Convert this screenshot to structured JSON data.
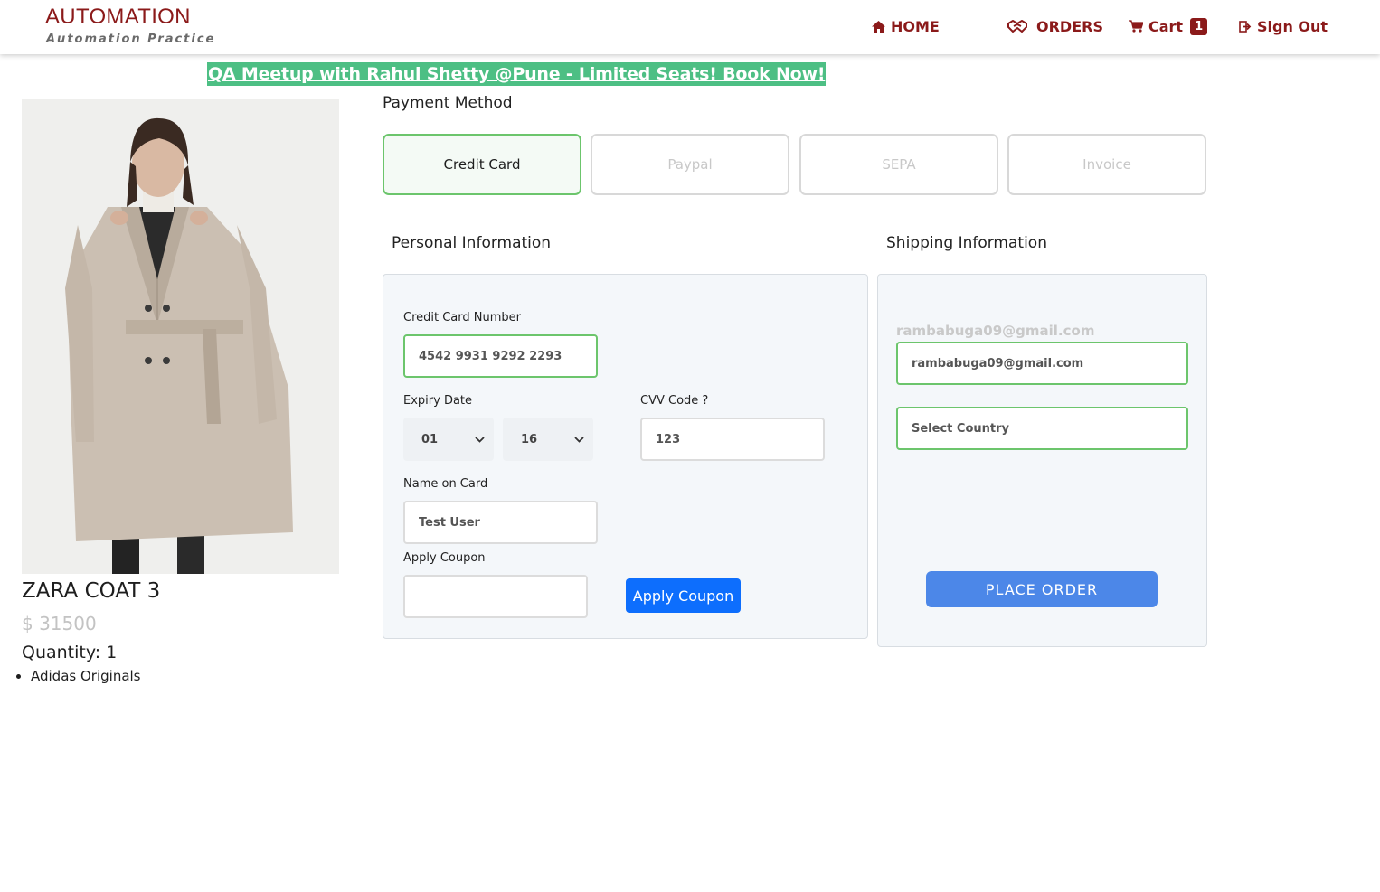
{
  "header": {
    "brand_title": "AUTOMATION",
    "brand_subtitle": "Automation Practice",
    "nav": {
      "home": "HOME",
      "orders": "ORDERS",
      "cart": "Cart",
      "cart_count": "1",
      "sign_out": "Sign Out"
    },
    "accent_color": "#8b1a1a"
  },
  "banner": {
    "text": "QA Meetup with Rahul Shetty @Pune - Limited Seats! Book Now!",
    "color": "#4dbf84"
  },
  "product": {
    "name": "ZARA COAT 3",
    "price": "$ 31500",
    "quantity": "Quantity: 1",
    "tags": [
      "Adidas Originals"
    ]
  },
  "payment": {
    "title": "Payment Method",
    "tabs": [
      {
        "label": "Credit Card",
        "active": true
      },
      {
        "label": "Paypal",
        "active": false
      },
      {
        "label": "SEPA",
        "active": false
      },
      {
        "label": "Invoice",
        "active": false
      }
    ]
  },
  "personal": {
    "title": "Personal Information",
    "card_number_label": "Credit Card Number",
    "card_number_value": "4542 9931 9292 2293",
    "expiry_label": "Expiry Date",
    "expiry_month": "01",
    "expiry_year": "16",
    "cvv_label": "CVV Code ?",
    "cvv_value": "123",
    "name_label": "Name on Card",
    "name_value": "Test User",
    "coupon_label": "Apply Coupon",
    "coupon_value": "",
    "coupon_button": "Apply Coupon"
  },
  "shipping": {
    "title": "Shipping Information",
    "email_display": "rambabuga09@gmail.com",
    "email_value": "rambabuga09@gmail.com",
    "country_placeholder": "Select Country",
    "place_order_button": "PLACE ORDER",
    "button_color": "#4c87e8"
  }
}
